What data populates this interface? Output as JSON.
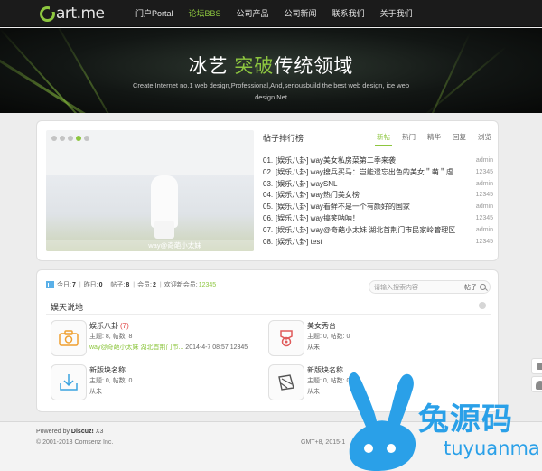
{
  "nav": {
    "logo_text": "art.me",
    "items": [
      {
        "label": "门户Portal"
      },
      {
        "label": "论坛BBS"
      },
      {
        "label": "公司产品"
      },
      {
        "label": "公司新闻"
      },
      {
        "label": "联系我们"
      },
      {
        "label": "关于我们"
      }
    ],
    "active_index": 1
  },
  "hero": {
    "title_pre": "冰艺 ",
    "title_highlight": "突破",
    "title_post": "传统领域",
    "subtitle": "Create Internet no.1 web design,Professional,And,seriousbuild the best web design, ice web design Net"
  },
  "slider": {
    "caption": "way@奇葩小太妹",
    "dots": [
      false,
      false,
      false,
      true,
      false
    ]
  },
  "ranking": {
    "title": "帖子排行榜",
    "tabs": [
      {
        "label": "新帖"
      },
      {
        "label": "热门"
      },
      {
        "label": "精华"
      },
      {
        "label": "回复"
      },
      {
        "label": "浏览"
      }
    ],
    "active_tab": 0,
    "items": [
      {
        "num": "01.",
        "title": "[娱乐八卦] way美女私房菜第二季来袭",
        "meta": "admin"
      },
      {
        "num": "02.",
        "title": "[娱乐八卦] way搜兵买马：岂能遗忘出色的美女＂萌＂虐",
        "meta": "12345"
      },
      {
        "num": "03.",
        "title": "[娱乐八卦] waySNL",
        "meta": "admin"
      },
      {
        "num": "04.",
        "title": "[娱乐八卦] way热门美女榜",
        "meta": "12345"
      },
      {
        "num": "05.",
        "title": "[娱乐八卦] way看鲜不是一个有颜好的国家",
        "meta": "admin"
      },
      {
        "num": "06.",
        "title": "[娱乐八卦] way搞笑呐呐！",
        "meta": "12345"
      },
      {
        "num": "07.",
        "title": "[娱乐八卦] way@奇葩小太妹 湖北首荆门市民家岭管理区",
        "meta": "admin"
      },
      {
        "num": "08.",
        "title": "[娱乐八卦] test",
        "meta": "12345"
      }
    ]
  },
  "stats": {
    "today_label": "今日:",
    "today": "7",
    "yesterday_label": "昨日:",
    "yesterday": "0",
    "posts_label": "帖子:",
    "posts": "8",
    "members_label": "会员:",
    "members": "2",
    "newest_label": "欢迎新会员:",
    "newest": "12345"
  },
  "search": {
    "placeholder": "请输入搜索内容",
    "type": "帖子"
  },
  "section": {
    "title": "娱天说地"
  },
  "forums": [
    {
      "name": "娱乐八卦",
      "today": "(7)",
      "stat": "主题: 8, 帖数: 8",
      "last_link": "way@奇葩小太妹 湖北首荆门市...",
      "last_time": "2014-4-7 08:57 12345",
      "icon": "camera-icon"
    },
    {
      "name": "美女秀台",
      "today": "",
      "stat": "主题: 0, 帖数: 0",
      "last_link": "",
      "last_time": "从未",
      "icon": "medal-icon"
    },
    {
      "name": "新版块名称",
      "today": "",
      "stat": "主题: 0, 帖数: 0",
      "last_link": "",
      "last_time": "从未",
      "icon": "download-icon"
    },
    {
      "name": "新版块名称",
      "today": "",
      "stat": "主题: 0, 帖数: 0",
      "last_link": "",
      "last_time": "从未",
      "icon": "edit-icon"
    }
  ],
  "footer": {
    "powered_prefix": "Powered by ",
    "powered_name": "Discuz!",
    "powered_ver": " X3",
    "copyright": "© 2001-2013 Comsenz Inc.",
    "gmt": "GMT+8, 2015-1"
  },
  "watermark": {
    "text": "兔源码",
    "pinyin": "tuyuanma"
  },
  "colors": {
    "accent": "#8dc63f",
    "watermark": "#2aa0e8"
  }
}
